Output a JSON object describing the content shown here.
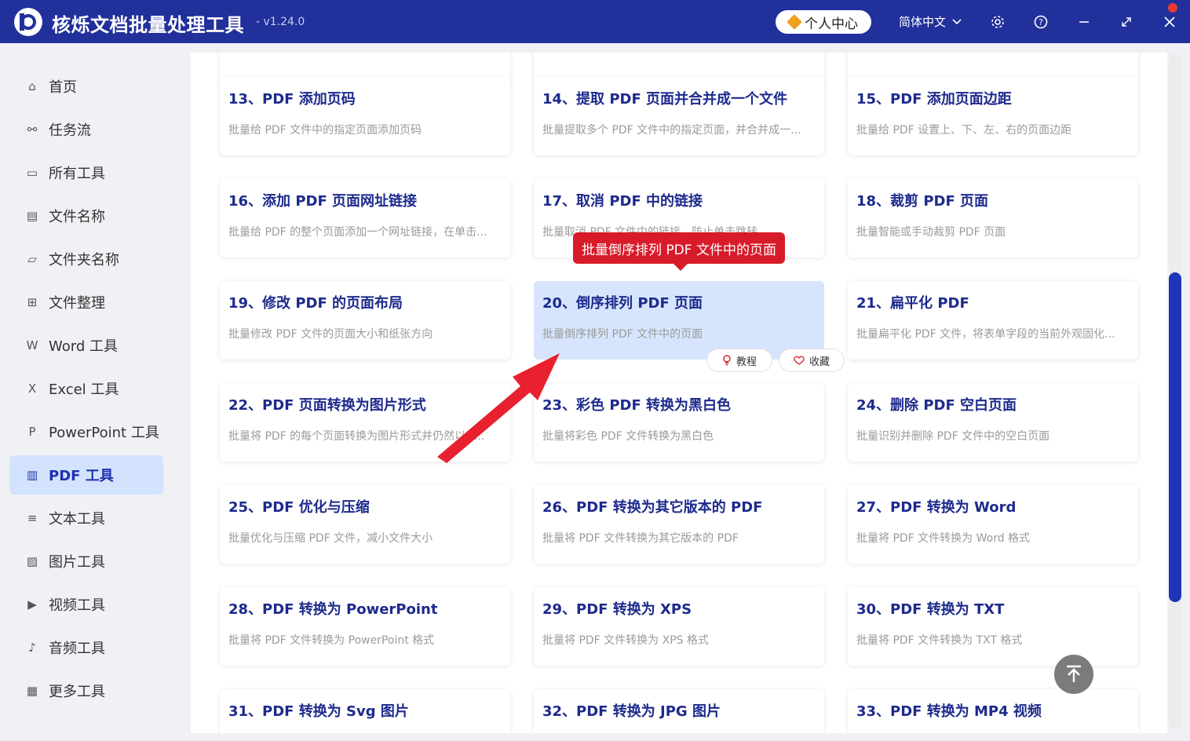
{
  "app": {
    "title": "核烁文档批量处理工具",
    "version": "- v1.24.0",
    "profile_label": "个人中心",
    "language": "简体中文",
    "colors": {
      "brand": "#21309a",
      "accent": "#1d2a8c",
      "tooltip": "#d81b2a",
      "active_bg": "#d3e3fd"
    }
  },
  "titlebar_icons": [
    "settings-icon",
    "help-icon",
    "minimize-icon",
    "maximize-icon",
    "close-icon"
  ],
  "sidebar": {
    "items": [
      {
        "label": "首页",
        "icon": "home-icon"
      },
      {
        "label": "任务流",
        "icon": "workflow-icon"
      },
      {
        "label": "所有工具",
        "icon": "monitor-icon"
      },
      {
        "label": "文件名称",
        "icon": "file-name-icon"
      },
      {
        "label": "文件夹名称",
        "icon": "folder-icon"
      },
      {
        "label": "文件整理",
        "icon": "organize-icon"
      },
      {
        "label": "Word 工具",
        "icon": "word-icon"
      },
      {
        "label": "Excel 工具",
        "icon": "excel-icon"
      },
      {
        "label": "PowerPoint 工具",
        "icon": "ppt-icon"
      },
      {
        "label": "PDF 工具",
        "icon": "pdf-icon",
        "active": true
      },
      {
        "label": "文本工具",
        "icon": "text-icon"
      },
      {
        "label": "图片工具",
        "icon": "image-icon"
      },
      {
        "label": "视频工具",
        "icon": "video-icon"
      },
      {
        "label": "音频工具",
        "icon": "audio-icon"
      },
      {
        "label": "更多工具",
        "icon": "grid-icon"
      }
    ]
  },
  "tools": [
    {
      "title": "13、PDF 添加页码",
      "desc": "批量给 PDF 文件中的指定页面添加页码"
    },
    {
      "title": "14、提取 PDF 页面并合并成一个文件",
      "desc": "批量提取多个 PDF 文件中的指定页面，并合并成一..."
    },
    {
      "title": "15、PDF 添加页面边距",
      "desc": "批量给 PDF 设置上、下、左、右的页面边距"
    },
    {
      "title": "16、添加 PDF 页面网址链接",
      "desc": "批量给 PDF 的整个页面添加一个网址链接，在单击..."
    },
    {
      "title": "17、取消 PDF 中的链接",
      "desc": "批量取消 PDF 文件中的链接，防止单击跳转"
    },
    {
      "title": "18、裁剪 PDF 页面",
      "desc": "批量智能或手动裁剪 PDF 页面"
    },
    {
      "title": "19、修改 PDF 的页面布局",
      "desc": "批量修改 PDF 文件的页面大小和纸张方向"
    },
    {
      "title": "20、倒序排列 PDF 页面",
      "desc": "批量倒序排列 PDF 文件中的页面",
      "selected": true
    },
    {
      "title": "21、扁平化 PDF",
      "desc": "批量扁平化 PDF 文件，将表单字段的当前外观固化..."
    },
    {
      "title": "22、PDF 页面转换为图片形式",
      "desc": "批量将 PDF 的每个页面转换为图片形式并仍然以 P..."
    },
    {
      "title": "23、彩色 PDF 转换为黑白色",
      "desc": "批量将彩色 PDF 文件转换为黑白色"
    },
    {
      "title": "24、删除 PDF 空白页面",
      "desc": "批量识别并删除 PDF 文件中的空白页面"
    },
    {
      "title": "25、PDF 优化与压缩",
      "desc": "批量优化与压缩 PDF 文件，减小文件大小"
    },
    {
      "title": "26、PDF 转换为其它版本的 PDF",
      "desc": "批量将 PDF 文件转换为其它版本的 PDF"
    },
    {
      "title": "27、PDF 转换为 Word",
      "desc": "批量将 PDF 文件转换为 Word 格式"
    },
    {
      "title": "28、PDF 转换为 PowerPoint",
      "desc": "批量将 PDF 文件转换为 PowerPoint 格式"
    },
    {
      "title": "29、PDF 转换为 XPS",
      "desc": "批量将 PDF 文件转换为 XPS 格式"
    },
    {
      "title": "30、PDF 转换为 TXT",
      "desc": "批量将 PDF 文件转换为 TXT 格式"
    },
    {
      "title": "31、PDF 转换为 Svg 图片",
      "desc": ""
    },
    {
      "title": "32、PDF 转换为 JPG 图片",
      "desc": ""
    },
    {
      "title": "33、PDF 转换为 MP4 视频",
      "desc": ""
    }
  ],
  "card_actions": {
    "tutorial": "教程",
    "favorite": "收藏"
  },
  "tooltip": "批量倒序排列 PDF 文件中的页面"
}
